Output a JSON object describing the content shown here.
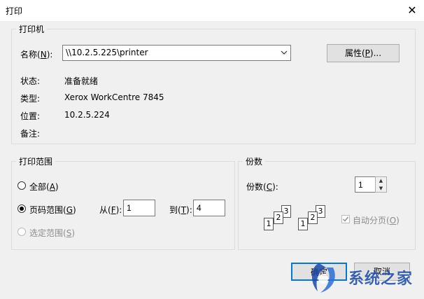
{
  "window": {
    "title": "打印",
    "close_glyph": "✕"
  },
  "printer": {
    "group_label": "打印机",
    "name_label": "名称",
    "name_key": "N",
    "name_value": "\\\\10.2.5.225\\printer",
    "properties_label": "属性",
    "properties_key": "P",
    "properties_suffix": "...",
    "status_label": "状态:",
    "status_value": "准备就绪",
    "type_label": "类型:",
    "type_value": "Xerox WorkCentre 7845",
    "location_label": "位置:",
    "location_value": "10.2.5.224",
    "comment_label": "备注:",
    "comment_value": ""
  },
  "range": {
    "group_label": "打印范围",
    "all_label": "全部",
    "all_key": "A",
    "pages_label": "页码范围",
    "pages_key": "G",
    "from_label": "从",
    "from_key": "F",
    "from_value": "1",
    "to_label": "到",
    "to_key": "T",
    "to_value": "4",
    "selection_label": "选定范围",
    "selection_key": "S",
    "selected": "pages"
  },
  "copies": {
    "group_label": "份数",
    "count_label": "份数",
    "count_key": "C",
    "count_value": "1",
    "collate_label": "自动分页",
    "collate_key": "O",
    "collate_checked": true,
    "collate_pages": [
      "1",
      "2",
      "3"
    ]
  },
  "footer": {
    "ok_label": "确定",
    "cancel_label": "取消"
  },
  "watermark": {
    "text": "系统之家"
  },
  "colors": {
    "accent": "#0078d7",
    "watermark": "#1a4aa8"
  }
}
